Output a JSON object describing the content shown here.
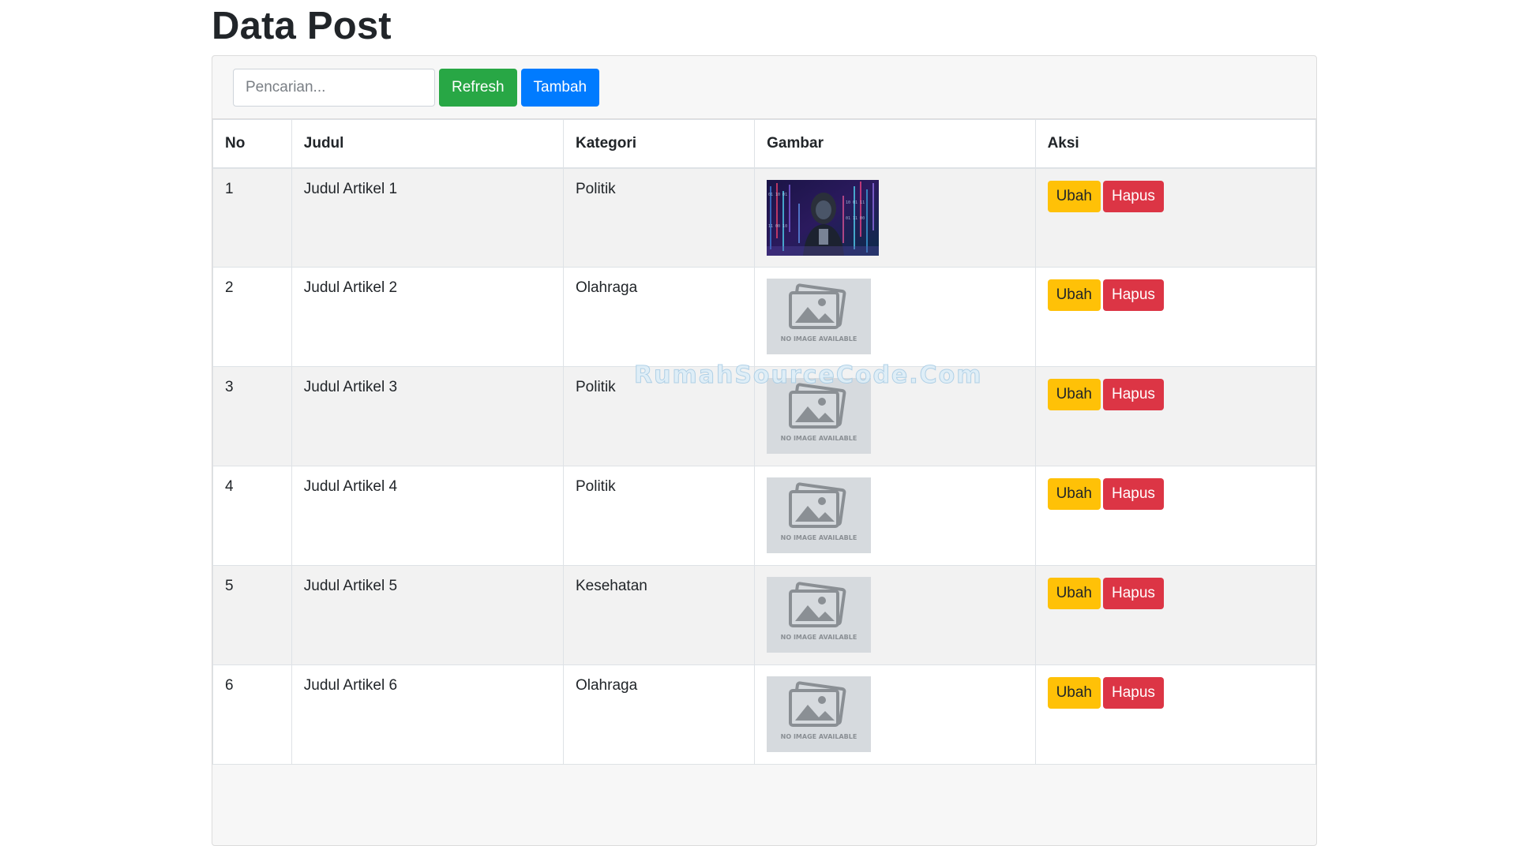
{
  "page": {
    "title": "Data Post"
  },
  "toolbar": {
    "search_placeholder": "Pencarian...",
    "refresh_label": "Refresh",
    "add_label": "Tambah"
  },
  "table": {
    "headers": [
      "No",
      "Judul",
      "Kategori",
      "Gambar",
      "Aksi"
    ],
    "rows": [
      {
        "no": "1",
        "judul": "Judul Artikel 1",
        "kategori": "Politik",
        "gambar": "photo",
        "edit": "Ubah",
        "delete": "Hapus"
      },
      {
        "no": "2",
        "judul": "Judul Artikel 2",
        "kategori": "Olahraga",
        "gambar": "no-image",
        "edit": "Ubah",
        "delete": "Hapus"
      },
      {
        "no": "3",
        "judul": "Judul Artikel 3",
        "kategori": "Politik",
        "gambar": "no-image",
        "edit": "Ubah",
        "delete": "Hapus"
      },
      {
        "no": "4",
        "judul": "Judul Artikel 4",
        "kategori": "Politik",
        "gambar": "no-image",
        "edit": "Ubah",
        "delete": "Hapus"
      },
      {
        "no": "5",
        "judul": "Judul Artikel 5",
        "kategori": "Kesehatan",
        "gambar": "no-image",
        "edit": "Ubah",
        "delete": "Hapus"
      },
      {
        "no": "6",
        "judul": "Judul Artikel 6",
        "kategori": "Olahraga",
        "gambar": "no-image",
        "edit": "Ubah",
        "delete": "Hapus"
      }
    ]
  },
  "placeholder_image_text": "NO IMAGE AVAILABLE",
  "watermark": "RumahSourceCode.Com",
  "colors": {
    "refresh": "#28a745",
    "add": "#007bff",
    "edit": "#ffc107",
    "delete": "#dc3545",
    "stripe": "#f2f2f2"
  }
}
